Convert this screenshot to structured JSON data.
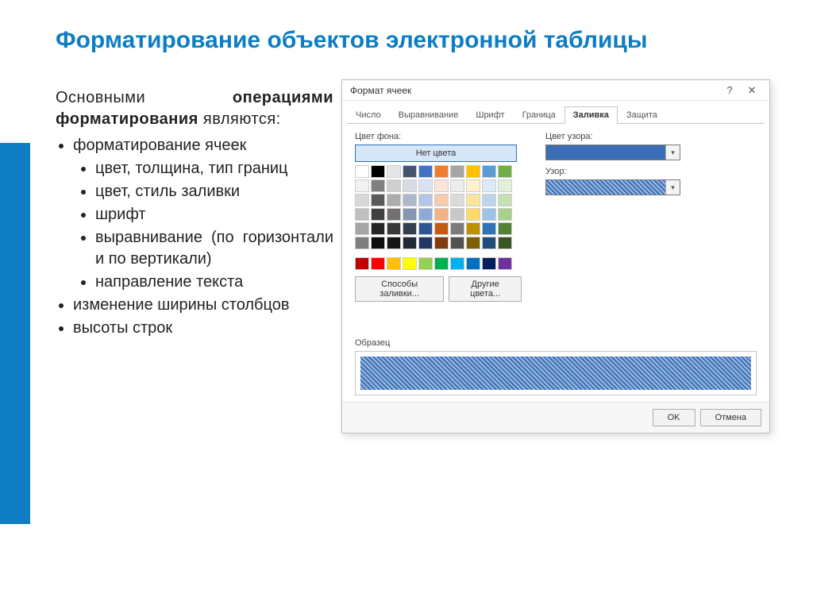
{
  "slide": {
    "title": "Форматирование объектов электронной таблицы",
    "intro_1": "Основными",
    "intro_2_bold": "операциями форматирования",
    "intro_3": "являются:",
    "bullets": {
      "l1_a": "форматирование ячеек",
      "l2_a": "цвет, толщина, тип границ",
      "l2_b": "цвет, стиль заливки",
      "l2_c": "шрифт",
      "l2_d": "выравнивание (по горизонтали и по вертикали)",
      "l2_e": "направление текста",
      "l1_b": "изменение ширины столбцов",
      "l1_c": "высоты строк"
    }
  },
  "dialog": {
    "title": "Формат ячеек",
    "tabs": [
      "Число",
      "Выравнивание",
      "Шрифт",
      "Граница",
      "Заливка",
      "Защита"
    ],
    "active_tab_index": 4,
    "bg_label": "Цвет фона:",
    "no_color": "Нет цвета",
    "pattern_color_label": "Цвет узора:",
    "pattern_label": "Узор:",
    "fill_methods_btn": "Способы заливки...",
    "other_colors_btn": "Другие цвета...",
    "sample_label": "Образец",
    "ok": "OK",
    "cancel": "Отмена",
    "palette": {
      "theme_row": [
        "#ffffff",
        "#000000",
        "#e7e6e6",
        "#44546a",
        "#4472c4",
        "#ed7d31",
        "#a5a5a5",
        "#ffc000",
        "#5b9bd5",
        "#70ad47"
      ],
      "tints": [
        [
          "#f2f2f2",
          "#808080",
          "#d0cece",
          "#d6dce5",
          "#d9e2f3",
          "#fbe5d5",
          "#ededed",
          "#fff2cc",
          "#deebf6",
          "#e2efd9"
        ],
        [
          "#d9d9d9",
          "#595959",
          "#aeabab",
          "#adb9ca",
          "#b4c6e7",
          "#f7cbac",
          "#dbdbdb",
          "#fee599",
          "#bdd6ee",
          "#c5e0b3"
        ],
        [
          "#bfbfbf",
          "#404040",
          "#757070",
          "#8496b0",
          "#8eaadb",
          "#f4b183",
          "#c9c9c9",
          "#ffd965",
          "#9cc3e5",
          "#a8d08d"
        ],
        [
          "#a6a6a6",
          "#262626",
          "#3a3838",
          "#323f4f",
          "#2f5496",
          "#c55a11",
          "#7b7b7b",
          "#bf9000",
          "#2e75b5",
          "#538135"
        ],
        [
          "#7f7f7f",
          "#0d0d0d",
          "#171616",
          "#222a35",
          "#1f3864",
          "#833c0b",
          "#525252",
          "#7f6000",
          "#1e4e79",
          "#375623"
        ]
      ],
      "standard": [
        "#c00000",
        "#ff0000",
        "#ffc000",
        "#ffff00",
        "#92d050",
        "#00b050",
        "#00b0f0",
        "#0070c0",
        "#002060",
        "#7030a0"
      ]
    }
  }
}
